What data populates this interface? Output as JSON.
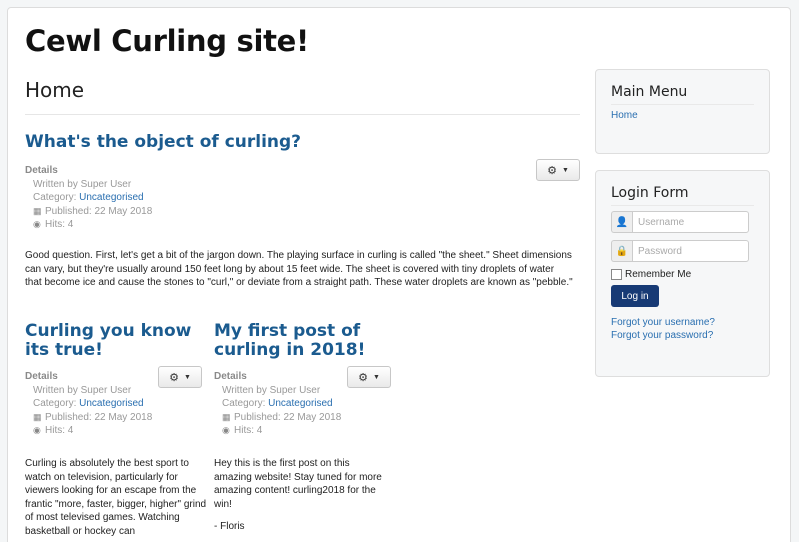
{
  "site": {
    "title": "Cewl Curling site!"
  },
  "page": {
    "heading": "Home"
  },
  "articles": [
    {
      "title": "What's the object of curling?",
      "details_label": "Details",
      "written_by": "Written by Super User",
      "category_label": "Category:",
      "category": "Uncategorised",
      "published": "Published: 22 May 2018",
      "hits": "Hits: 4",
      "body": "Good question. First, let's get a bit of the jargon down. The playing surface in curling is called \"the sheet.\" Sheet dimensions can vary, but they're usually around 150 feet long by about 15 feet wide. The sheet is covered with tiny droplets of water that become ice and cause the stones to \"curl,\" or deviate from a straight path. These water droplets are known as \"pebble.\""
    },
    {
      "title": "Curling you know its true!",
      "details_label": "Details",
      "written_by": "Written by Super User",
      "category_label": "Category:",
      "category": "Uncategorised",
      "published": "Published: 22 May 2018",
      "hits": "Hits: 4",
      "body": "Curling is absolutely the best sport to watch on television, particularly for viewers looking for an escape from the frantic \"more, faster, bigger, higher\" grind of most televised games. Watching basketball or hockey can"
    },
    {
      "title": "My first post of curling in 2018!",
      "details_label": "Details",
      "written_by": "Written by Super User",
      "category_label": "Category:",
      "category": "Uncategorised",
      "published": "Published: 22 May 2018",
      "hits": "Hits: 4",
      "body": "Hey this is the first post on this amazing website! Stay tuned for more amazing content! curling2018 for the win!",
      "signature": "- Floris"
    }
  ],
  "icons": {
    "gear": "gear-icon",
    "caret": "caret-down-icon",
    "calendar": "calendar-icon",
    "eye": "eye-icon",
    "user": "user-icon",
    "lock": "lock-icon"
  },
  "main_menu": {
    "title": "Main Menu",
    "items": [
      {
        "label": "Home"
      }
    ]
  },
  "login_form": {
    "title": "Login Form",
    "username_placeholder": "Username",
    "password_placeholder": "Password",
    "remember_label": "Remember Me",
    "login_label": "Log in",
    "forgot_username": "Forgot your username?",
    "forgot_password": "Forgot your password?"
  },
  "colors": {
    "link": "#2a6fb0",
    "title": "#1b5b8f",
    "button": "#173a75"
  }
}
